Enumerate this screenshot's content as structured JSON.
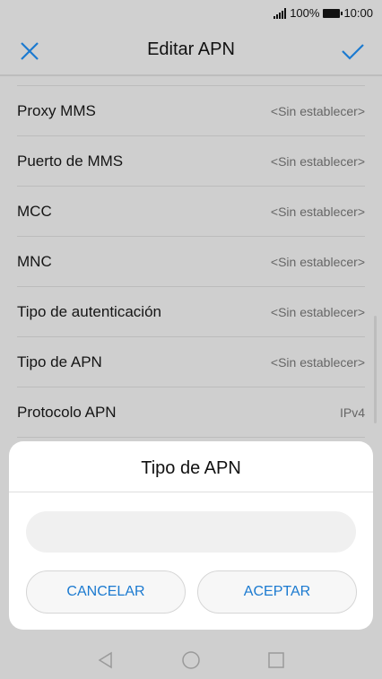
{
  "status": {
    "battery": "100%",
    "time": "10:00"
  },
  "toolbar": {
    "title": "Editar APN",
    "close_icon": "close-icon",
    "confirm_icon": "check-icon",
    "accent": "#1b7ad0"
  },
  "settings": [
    {
      "label": "Proxy MMS",
      "value": "<Sin establecer>"
    },
    {
      "label": "Puerto de MMS",
      "value": "<Sin establecer>"
    },
    {
      "label": "MCC",
      "value": "<Sin establecer>"
    },
    {
      "label": "MNC",
      "value": "<Sin establecer>"
    },
    {
      "label": "Tipo de autenticación",
      "value": "<Sin establecer>"
    },
    {
      "label": "Tipo de APN",
      "value": "<Sin establecer>"
    },
    {
      "label": "Protocolo APN",
      "value": "IPv4"
    }
  ],
  "dialog": {
    "title": "Tipo de APN",
    "input_value": "",
    "cancel_label": "CANCELAR",
    "ok_label": "ACEPTAR"
  },
  "navbar": {
    "icons": [
      "back-icon",
      "home-icon",
      "recents-icon"
    ]
  }
}
